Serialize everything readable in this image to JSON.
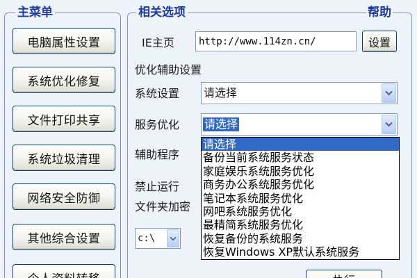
{
  "main_menu": {
    "title": "主菜单",
    "items": [
      {
        "label": "电脑属性设置"
      },
      {
        "label": "系统优化修复"
      },
      {
        "label": "文件打印共享"
      },
      {
        "label": "系统垃圾清理"
      },
      {
        "label": "网络安全防御"
      },
      {
        "label": "其他综合设置"
      },
      {
        "label": "个人资料转移"
      }
    ]
  },
  "options": {
    "title": "相关选项",
    "help_label": "帮助",
    "ie_homepage": {
      "label": "IE主页",
      "value": "http://www.114zn.cn/",
      "set_button": "设置"
    },
    "section_label": "优化辅助设置",
    "system_setting": {
      "label": "系统设置",
      "value": "请选择"
    },
    "service_optimize": {
      "label": "服务优化",
      "value": "请选择",
      "options": [
        "请选择",
        "备份当前系统服务状态",
        "家庭娱乐系统服务优化",
        "商务办公系统服务优化",
        "笔记本系统服务优化",
        "网吧系统服务优化",
        "最精简系统服务优化",
        "恢复备份的系统服务",
        "恢复Windows XP默认系统服务"
      ],
      "highlighted_index": 0
    },
    "helper_program": {
      "label": "辅助程序"
    },
    "disable_run": {
      "label": "禁止运行"
    },
    "folder_encrypt": {
      "label": "文件夹加密"
    },
    "drive_select": {
      "value": "c:\\"
    },
    "execute_button": "执行"
  },
  "colors": {
    "accent_title": "#1d3aa8",
    "selection": "#316ac5",
    "button_border": "#003c74",
    "frame_border": "#7d97c2"
  }
}
